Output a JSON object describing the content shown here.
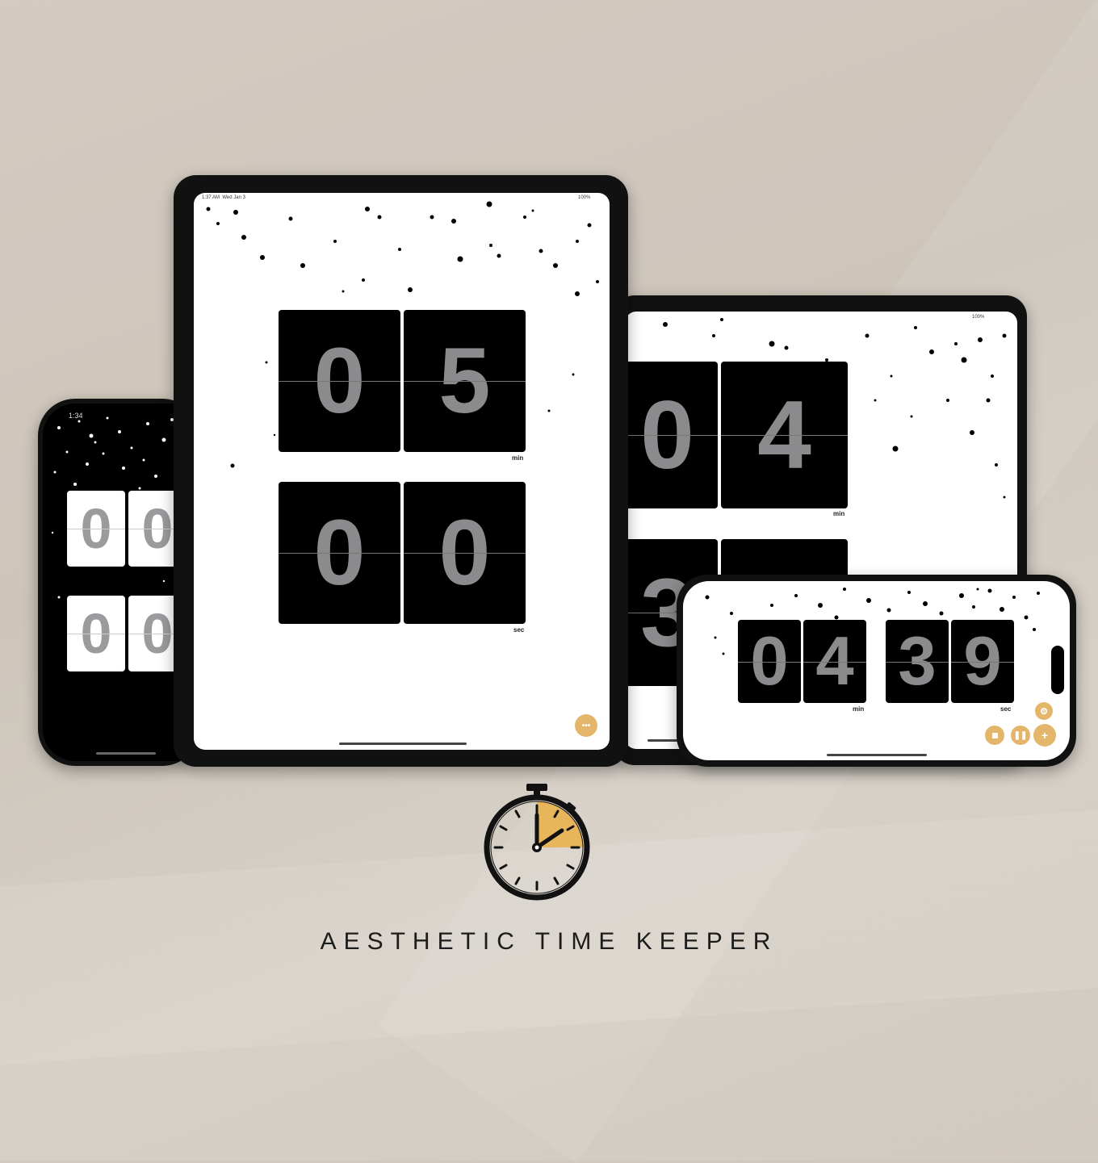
{
  "phone_portrait": {
    "status_time": "1:34",
    "digits": [
      "0",
      "0",
      "0",
      "0"
    ]
  },
  "ipad_portrait": {
    "status_time": "1:37 AM",
    "status_date": "Wed Jan 3",
    "battery": "100%",
    "minutes": [
      "0",
      "5"
    ],
    "seconds": [
      "0",
      "0"
    ],
    "min_label": "min",
    "sec_label": "sec",
    "menu_icon": "ellipsis-icon"
  },
  "ipad_landscape": {
    "battery": "100%",
    "minutes": [
      "0",
      "4"
    ],
    "seconds": [
      "3",
      ""
    ],
    "min_label": "min"
  },
  "phone_landscape": {
    "minutes": [
      "0",
      "4"
    ],
    "seconds": [
      "3",
      "9"
    ],
    "min_label": "min",
    "sec_label": "sec",
    "buttons": [
      "stop-icon",
      "pause-icon",
      "add-icon",
      "settings-icon"
    ]
  },
  "logo": {
    "icon": "stopwatch-icon",
    "accent": "#e8b65a"
  },
  "brand_title": "AESTHETIC TIME KEEPER"
}
